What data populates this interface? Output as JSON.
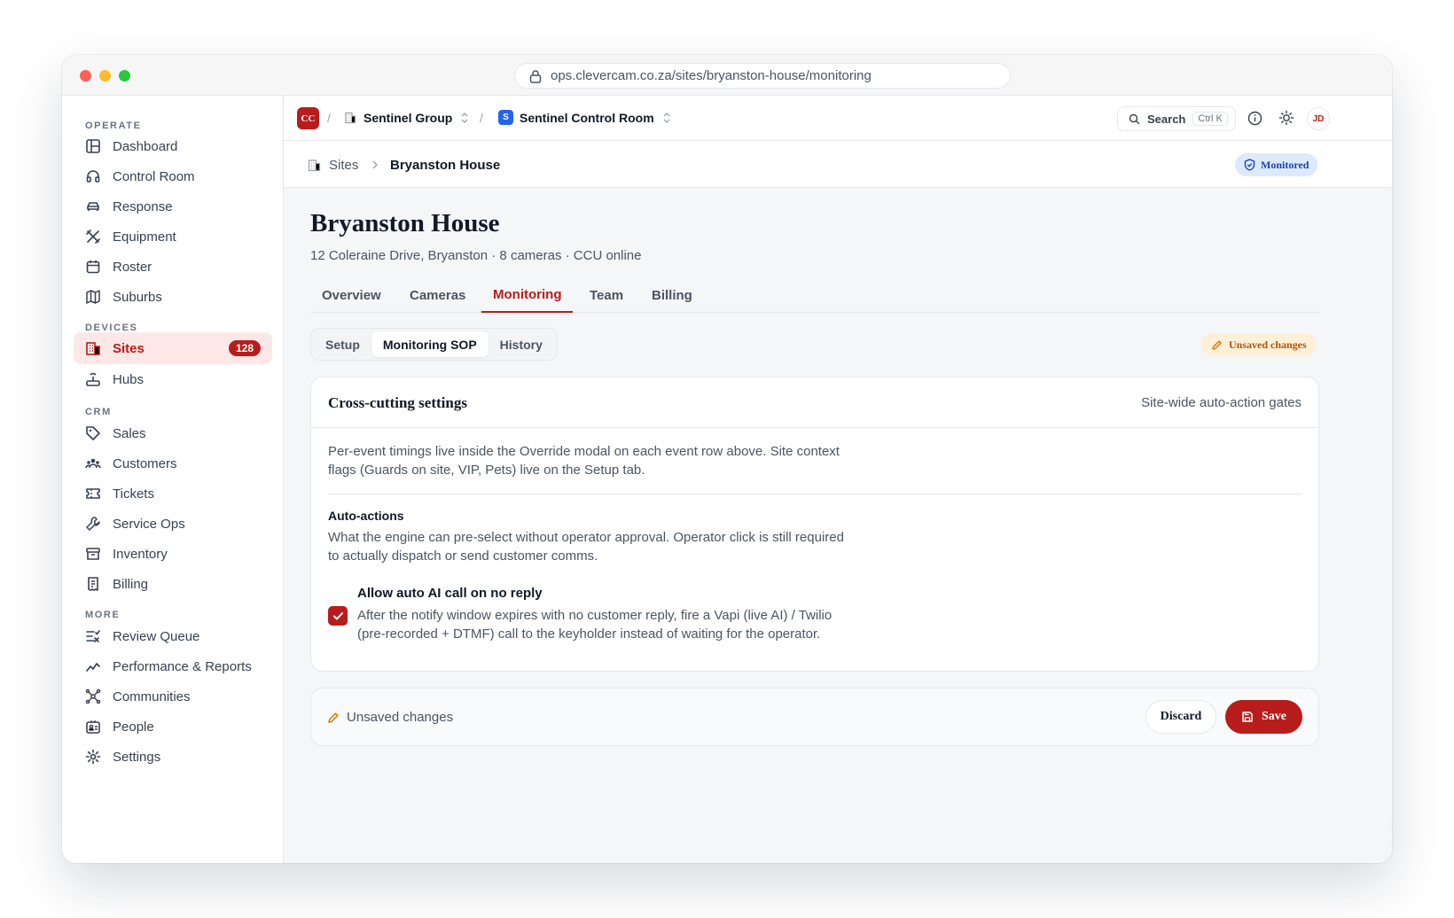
{
  "browser": {
    "url": "ops.clevercam.co.za/sites/bryanston-house/monitoring"
  },
  "sidebar": {
    "sections": [
      {
        "label": "OPERATE",
        "items": [
          {
            "label": "Dashboard",
            "icon": "layout-icon"
          },
          {
            "label": "Control Room",
            "icon": "headset-icon"
          },
          {
            "label": "Response",
            "icon": "car-icon"
          },
          {
            "label": "Equipment",
            "icon": "tools-icon"
          },
          {
            "label": "Roster",
            "icon": "calendar-icon"
          },
          {
            "label": "Suburbs",
            "icon": "map-icon"
          }
        ]
      },
      {
        "label": "DEVICES",
        "items": [
          {
            "label": "Sites",
            "icon": "building-icon",
            "badge": "128",
            "active": true
          },
          {
            "label": "Hubs",
            "icon": "router-icon"
          }
        ]
      },
      {
        "label": "CRM",
        "items": [
          {
            "label": "Sales",
            "icon": "tag-icon"
          },
          {
            "label": "Customers",
            "icon": "users-icon"
          },
          {
            "label": "Tickets",
            "icon": "ticket-icon"
          },
          {
            "label": "Service Ops",
            "icon": "wrench-icon"
          },
          {
            "label": "Inventory",
            "icon": "archive-icon"
          },
          {
            "label": "Billing",
            "icon": "receipt-icon"
          }
        ]
      },
      {
        "label": "MORE",
        "items": [
          {
            "label": "Review Queue",
            "icon": "list-check-icon"
          },
          {
            "label": "Performance & Reports",
            "icon": "chart-line-icon"
          },
          {
            "label": "Communities",
            "icon": "network-icon"
          },
          {
            "label": "People",
            "icon": "id-badge-icon"
          },
          {
            "label": "Settings",
            "icon": "gear-icon"
          }
        ]
      }
    ]
  },
  "topbar": {
    "org_logo": "CC",
    "org": "Sentinel Group",
    "workspace_badge": "S",
    "workspace": "Sentinel Control Room",
    "search_label": "Search",
    "search_shortcut": "Ctrl K",
    "avatar": "JD"
  },
  "breadcrumb": {
    "parent": "Sites",
    "current": "Bryanston House",
    "status": "Monitored"
  },
  "page": {
    "title": "Bryanston House",
    "subtitle": "12 Coleraine Drive, Bryanston · 8 cameras · CCU online",
    "tabs": [
      "Overview",
      "Cameras",
      "Monitoring",
      "Team",
      "Billing"
    ],
    "active_tab": "Monitoring",
    "subtabs": [
      "Setup",
      "Monitoring SOP",
      "History"
    ],
    "active_subtab": "Monitoring SOP",
    "unsaved_pill": "Unsaved changes"
  },
  "card": {
    "title": "Cross-cutting settings",
    "right_note": "Site-wide auto-action gates",
    "intro_line1": "Per-event timings live inside the Override modal on each event row above. Site context",
    "intro_line2": "flags (Guards on site, VIP, Pets) live on the Setup tab.",
    "section_title": "Auto-actions",
    "section_line1": "What the engine can pre-select without operator approval. Operator click is still required",
    "section_line2": "to actually dispatch or send customer comms.",
    "option_label": "Allow auto AI call on no reply",
    "option_checked": true,
    "option_line1": "After the notify window expires with no customer reply, fire a Vapi (live AI) / Twilio",
    "option_line2": "(pre-recorded + DTMF) call to the keyholder instead of waiting for the operator."
  },
  "footer": {
    "status": "Unsaved changes",
    "discard_label": "Discard",
    "save_label": "Save"
  },
  "colors": {
    "accent": "#b91c1c",
    "monitored_bg": "#dbeafe",
    "unsaved_bg": "#fdf0d8"
  }
}
